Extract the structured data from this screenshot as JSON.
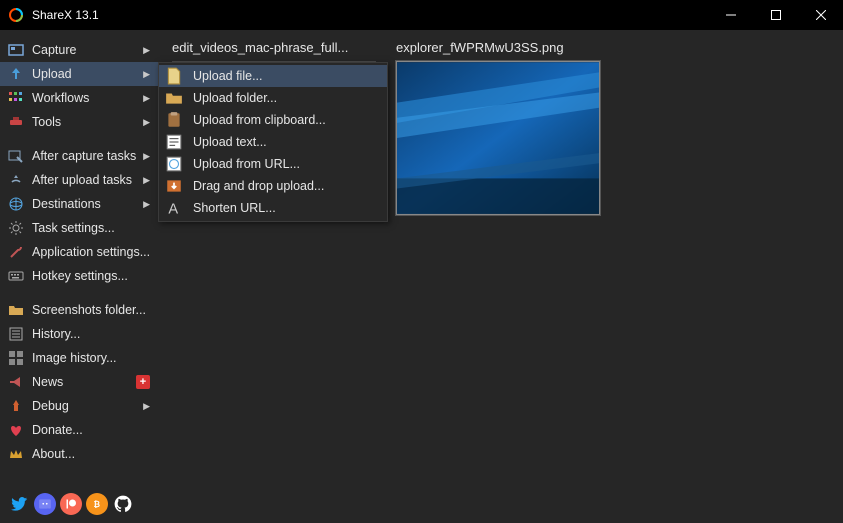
{
  "title": "ShareX 13.1",
  "sidebar": {
    "items": [
      {
        "label": "Capture",
        "icon": "capture",
        "arrow": true
      },
      {
        "label": "Upload",
        "icon": "upload",
        "arrow": true,
        "active": true
      },
      {
        "label": "Workflows",
        "icon": "workflows",
        "arrow": true
      },
      {
        "label": "Tools",
        "icon": "tools",
        "arrow": true
      }
    ],
    "group2": [
      {
        "label": "After capture tasks",
        "icon": "after-capture",
        "arrow": true
      },
      {
        "label": "After upload tasks",
        "icon": "after-upload",
        "arrow": true
      },
      {
        "label": "Destinations",
        "icon": "destinations",
        "arrow": true
      },
      {
        "label": "Task settings...",
        "icon": "task-settings"
      },
      {
        "label": "Application settings...",
        "icon": "app-settings"
      },
      {
        "label": "Hotkey settings...",
        "icon": "hotkey"
      }
    ],
    "group3": [
      {
        "label": "Screenshots folder...",
        "icon": "folder"
      },
      {
        "label": "History...",
        "icon": "history"
      },
      {
        "label": "Image history...",
        "icon": "image-history"
      },
      {
        "label": "News",
        "icon": "news",
        "badge": "+"
      },
      {
        "label": "Debug",
        "icon": "debug",
        "arrow": true
      },
      {
        "label": "Donate...",
        "icon": "donate"
      },
      {
        "label": "About...",
        "icon": "about"
      }
    ]
  },
  "upload_menu": [
    {
      "label": "Upload file...",
      "icon": "file",
      "hover": true
    },
    {
      "label": "Upload folder...",
      "icon": "folder"
    },
    {
      "label": "Upload from clipboard...",
      "icon": "clipboard"
    },
    {
      "label": "Upload text...",
      "icon": "text"
    },
    {
      "label": "Upload from URL...",
      "icon": "url"
    },
    {
      "label": "Drag and drop upload...",
      "icon": "drag"
    },
    {
      "label": "Shorten URL...",
      "icon": "shorten"
    }
  ],
  "content": {
    "items": [
      {
        "name": "edit_videos_mac-phrase_full..."
      },
      {
        "name": "explorer_fWPRMwU3SS.png",
        "selected": true,
        "preview": "win10"
      }
    ]
  },
  "social_names": [
    "twitter",
    "discord",
    "patreon",
    "bitcoin",
    "github"
  ]
}
